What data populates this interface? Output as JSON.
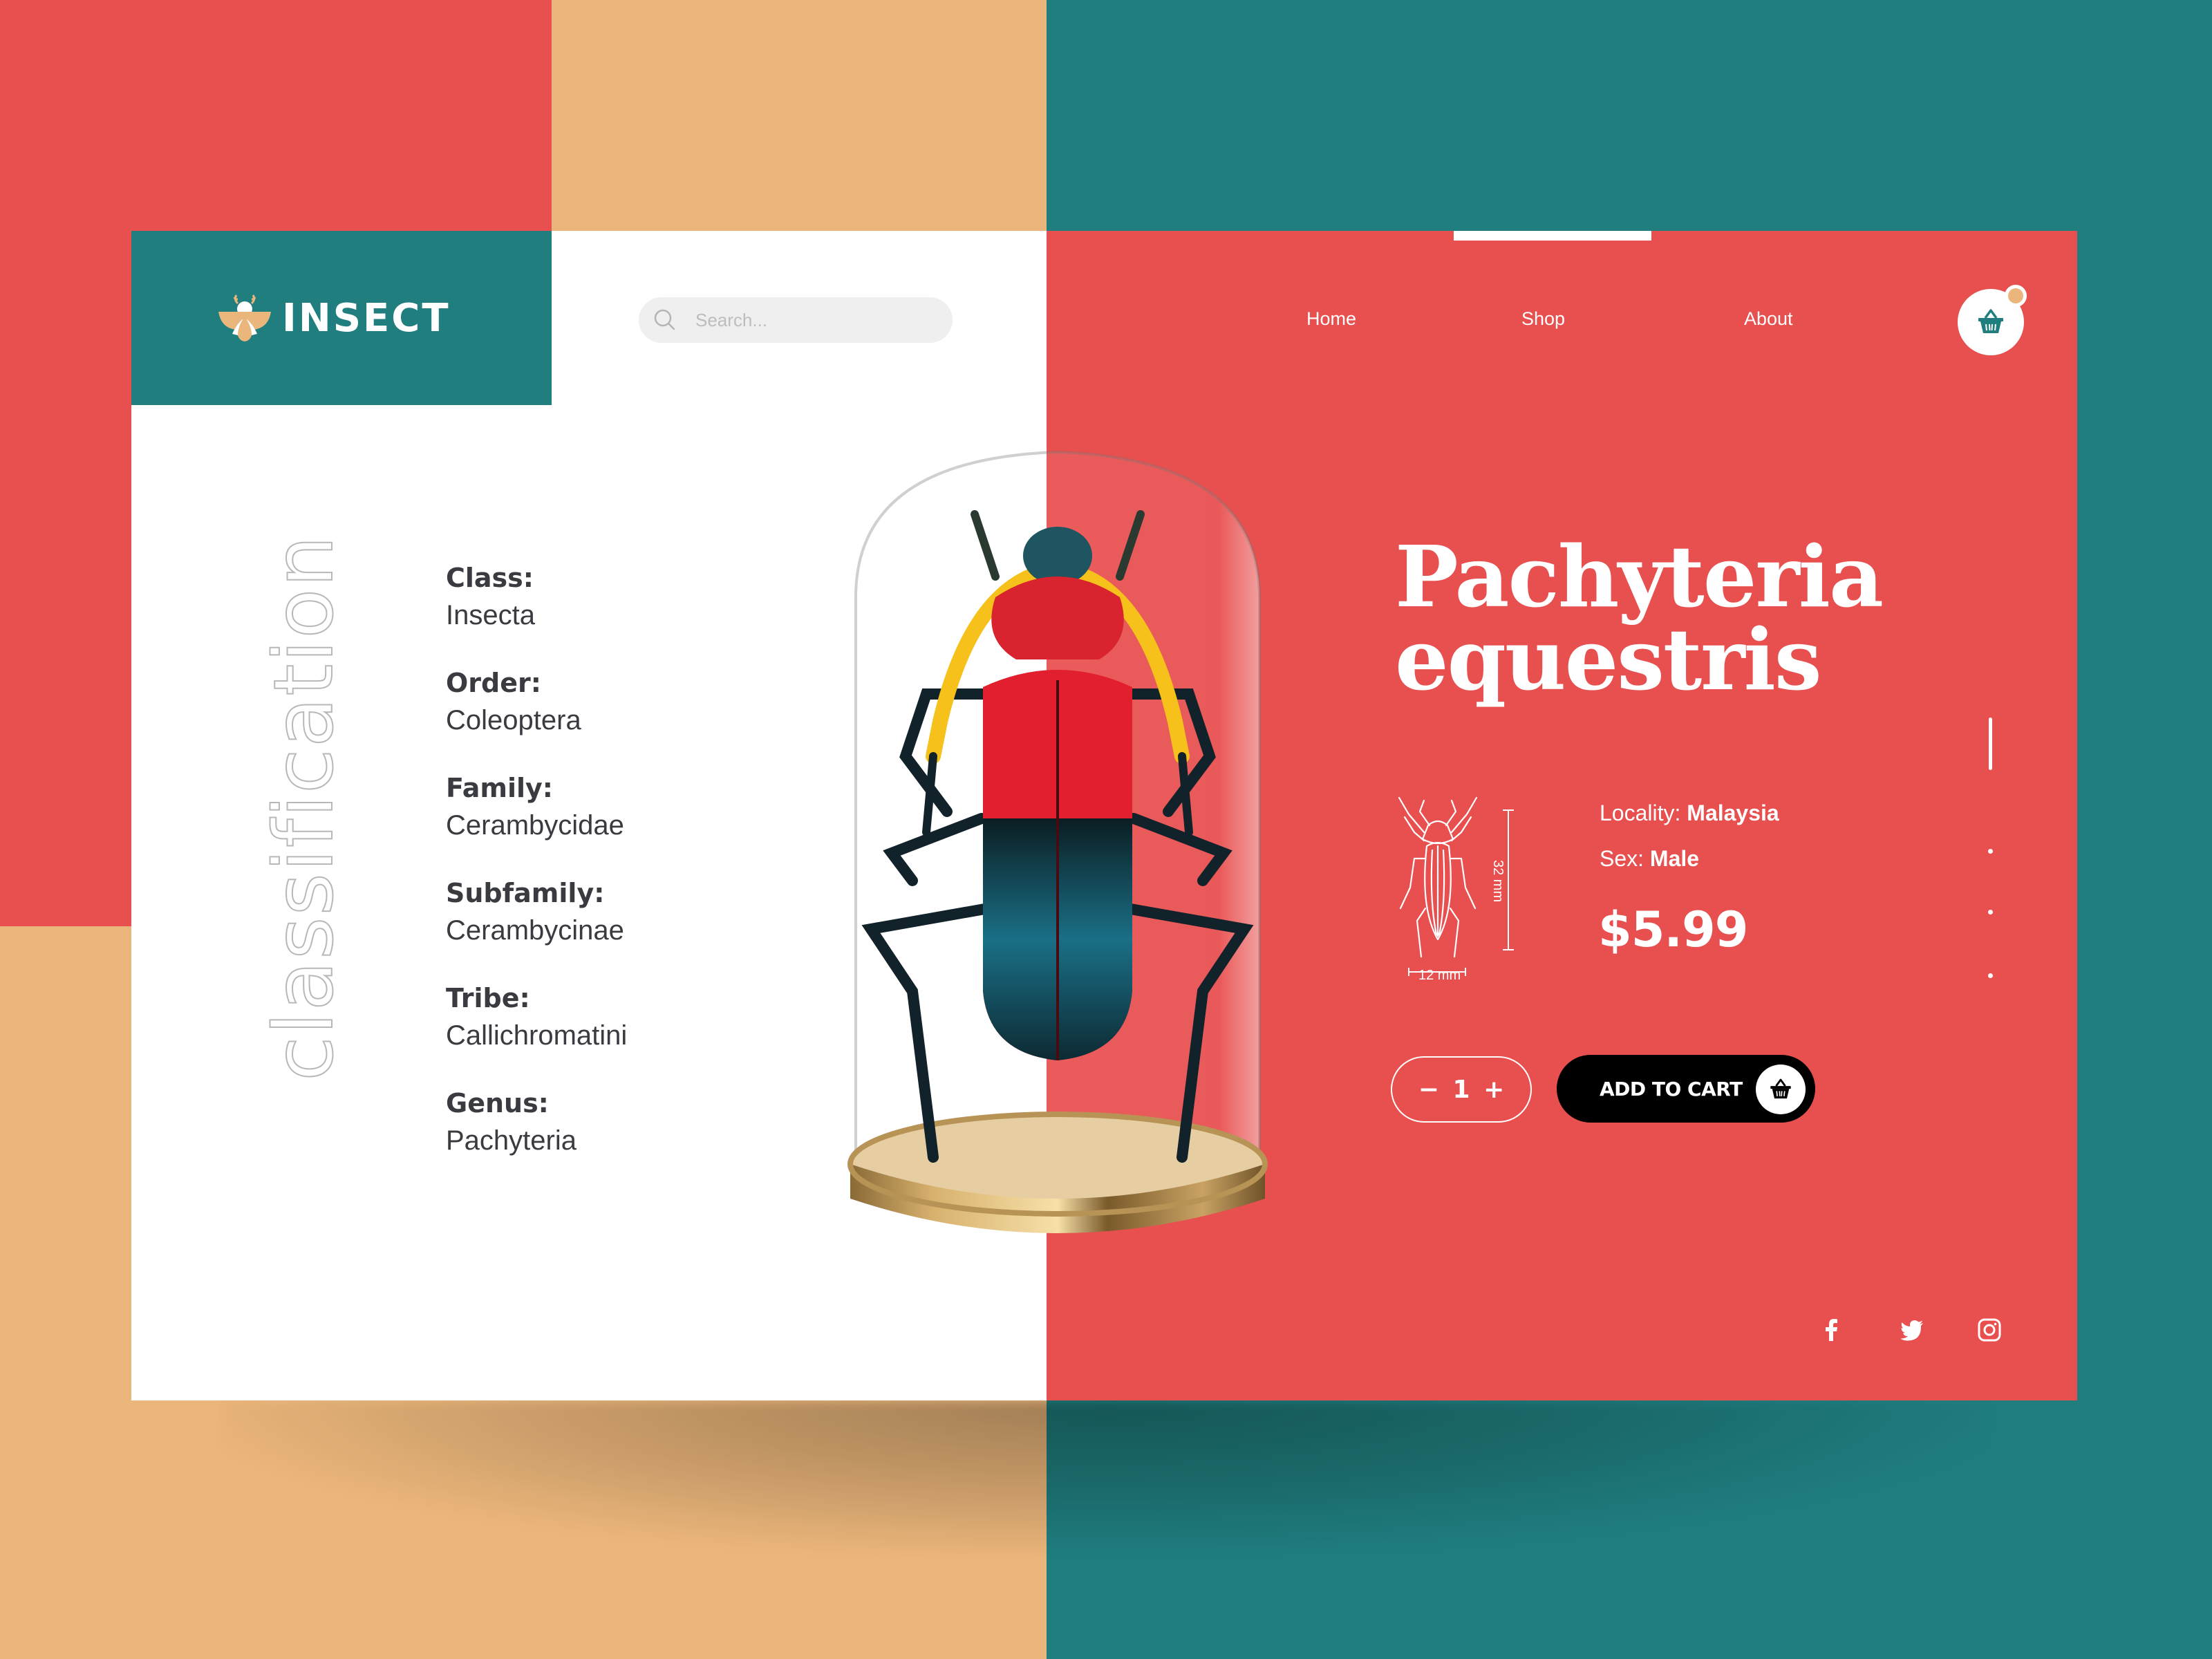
{
  "brand": {
    "name": "INSECT",
    "logo_icon": "bee-icon"
  },
  "search": {
    "placeholder": "Search...",
    "value": "",
    "icon": "search-icon"
  },
  "nav": {
    "items": [
      {
        "label": "Home",
        "active": false
      },
      {
        "label": "Shop",
        "active": true
      },
      {
        "label": "About",
        "active": false
      }
    ],
    "cart_icon": "basket-icon",
    "cart_has_items": true
  },
  "classification": {
    "heading": "classification",
    "items": [
      {
        "label": "Class:",
        "value": "Insecta"
      },
      {
        "label": "Order:",
        "value": "Coleoptera"
      },
      {
        "label": "Family:",
        "value": "Cerambycidae"
      },
      {
        "label": "Subfamily:",
        "value": "Cerambycinae"
      },
      {
        "label": "Tribe:",
        "value": "Callichromatini"
      },
      {
        "label": "Genus:",
        "value": "Pachyteria"
      }
    ]
  },
  "product": {
    "title_line1": "Pachyteria",
    "title_line2": "equestris",
    "image": "beetle-in-bell-jar",
    "dimensions": {
      "length": "32 mm",
      "width": "12 mm"
    },
    "locality_label": "Locality:",
    "locality": "Malaysia",
    "sex_label": "Sex:",
    "sex": "Male",
    "price": "$5.99",
    "quantity": "1",
    "qty_minus": "−",
    "qty_plus": "+",
    "add_to_cart_label": "ADD TO CART"
  },
  "slider": {
    "total": 4,
    "active_index": 0
  },
  "social": [
    "facebook",
    "twitter",
    "instagram"
  ],
  "colors": {
    "red": "#e84f4f",
    "teal": "#207e7f",
    "tan": "#ebb67b",
    "text_dark": "#3a3b40"
  }
}
